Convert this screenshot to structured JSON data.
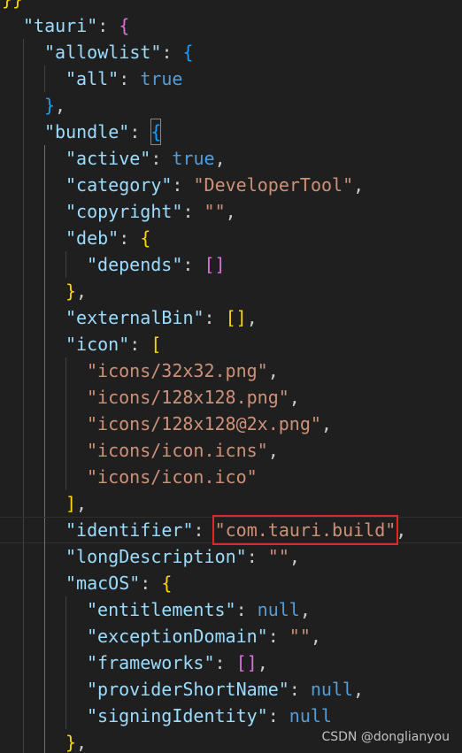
{
  "editor": {
    "language": "json",
    "lines": [
      {
        "indent": 0,
        "tokens": [
          {
            "t": "}}",
            "c": "brace-gold"
          }
        ]
      },
      {
        "indent": 1,
        "tokens": [
          {
            "t": "\"tauri\"",
            "c": "key"
          },
          {
            "t": ": ",
            "c": "punct"
          },
          {
            "t": "{",
            "c": "brace-purple"
          }
        ]
      },
      {
        "indent": 2,
        "tokens": [
          {
            "t": "\"allowlist\"",
            "c": "key"
          },
          {
            "t": ": ",
            "c": "punct"
          },
          {
            "t": "{",
            "c": "brace-blue"
          }
        ]
      },
      {
        "indent": 3,
        "tokens": [
          {
            "t": "\"all\"",
            "c": "key"
          },
          {
            "t": ": ",
            "c": "punct"
          },
          {
            "t": "true",
            "c": "kw"
          }
        ]
      },
      {
        "indent": 2,
        "tokens": [
          {
            "t": "}",
            "c": "brace-blue"
          },
          {
            "t": ",",
            "c": "punct"
          }
        ]
      },
      {
        "indent": 2,
        "tokens": [
          {
            "t": "\"bundle\"",
            "c": "key"
          },
          {
            "t": ": ",
            "c": "punct"
          },
          {
            "t": "{",
            "c": "brace-blue",
            "match": true
          }
        ]
      },
      {
        "indent": 3,
        "tokens": [
          {
            "t": "\"active\"",
            "c": "key"
          },
          {
            "t": ": ",
            "c": "punct"
          },
          {
            "t": "true",
            "c": "kw"
          },
          {
            "t": ",",
            "c": "punct"
          }
        ]
      },
      {
        "indent": 3,
        "tokens": [
          {
            "t": "\"category\"",
            "c": "key"
          },
          {
            "t": ": ",
            "c": "punct"
          },
          {
            "t": "\"DeveloperTool\"",
            "c": "str"
          },
          {
            "t": ",",
            "c": "punct"
          }
        ]
      },
      {
        "indent": 3,
        "tokens": [
          {
            "t": "\"copyright\"",
            "c": "key"
          },
          {
            "t": ": ",
            "c": "punct"
          },
          {
            "t": "\"\"",
            "c": "str"
          },
          {
            "t": ",",
            "c": "punct"
          }
        ]
      },
      {
        "indent": 3,
        "tokens": [
          {
            "t": "\"deb\"",
            "c": "key"
          },
          {
            "t": ": ",
            "c": "punct"
          },
          {
            "t": "{",
            "c": "brace-gold"
          }
        ]
      },
      {
        "indent": 4,
        "tokens": [
          {
            "t": "\"depends\"",
            "c": "key"
          },
          {
            "t": ": ",
            "c": "punct"
          },
          {
            "t": "[]",
            "c": "brace-purple"
          }
        ]
      },
      {
        "indent": 3,
        "tokens": [
          {
            "t": "}",
            "c": "brace-gold"
          },
          {
            "t": ",",
            "c": "punct"
          }
        ]
      },
      {
        "indent": 3,
        "tokens": [
          {
            "t": "\"externalBin\"",
            "c": "key"
          },
          {
            "t": ": ",
            "c": "punct"
          },
          {
            "t": "[]",
            "c": "brace-gold"
          },
          {
            "t": ",",
            "c": "punct"
          }
        ]
      },
      {
        "indent": 3,
        "tokens": [
          {
            "t": "\"icon\"",
            "c": "key"
          },
          {
            "t": ": ",
            "c": "punct"
          },
          {
            "t": "[",
            "c": "brace-gold"
          }
        ]
      },
      {
        "indent": 4,
        "tokens": [
          {
            "t": "\"icons/32x32.png\"",
            "c": "str"
          },
          {
            "t": ",",
            "c": "punct"
          }
        ]
      },
      {
        "indent": 4,
        "tokens": [
          {
            "t": "\"icons/128x128.png\"",
            "c": "str"
          },
          {
            "t": ",",
            "c": "punct"
          }
        ]
      },
      {
        "indent": 4,
        "tokens": [
          {
            "t": "\"icons/128x128@2x.png\"",
            "c": "str"
          },
          {
            "t": ",",
            "c": "punct"
          }
        ]
      },
      {
        "indent": 4,
        "tokens": [
          {
            "t": "\"icons/icon.icns\"",
            "c": "str"
          },
          {
            "t": ",",
            "c": "punct"
          }
        ]
      },
      {
        "indent": 4,
        "tokens": [
          {
            "t": "\"icons/icon.ico\"",
            "c": "str"
          }
        ]
      },
      {
        "indent": 3,
        "tokens": [
          {
            "t": "]",
            "c": "brace-gold"
          },
          {
            "t": ",",
            "c": "punct"
          }
        ]
      },
      {
        "indent": 3,
        "current": true,
        "tokens": [
          {
            "t": "\"identifier\"",
            "c": "key"
          },
          {
            "t": ": ",
            "c": "punct"
          },
          {
            "t": "\"com.tauri.build\"",
            "c": "str",
            "boxed": true
          },
          {
            "t": ",",
            "c": "punct"
          }
        ]
      },
      {
        "indent": 3,
        "tokens": [
          {
            "t": "\"longDescription\"",
            "c": "key"
          },
          {
            "t": ": ",
            "c": "punct"
          },
          {
            "t": "\"\"",
            "c": "str"
          },
          {
            "t": ",",
            "c": "punct"
          }
        ]
      },
      {
        "indent": 3,
        "tokens": [
          {
            "t": "\"macOS\"",
            "c": "key"
          },
          {
            "t": ": ",
            "c": "punct"
          },
          {
            "t": "{",
            "c": "brace-gold"
          }
        ]
      },
      {
        "indent": 4,
        "tokens": [
          {
            "t": "\"entitlements\"",
            "c": "key"
          },
          {
            "t": ": ",
            "c": "punct"
          },
          {
            "t": "null",
            "c": "kw"
          },
          {
            "t": ",",
            "c": "punct"
          }
        ]
      },
      {
        "indent": 4,
        "tokens": [
          {
            "t": "\"exceptionDomain\"",
            "c": "key"
          },
          {
            "t": ": ",
            "c": "punct"
          },
          {
            "t": "\"\"",
            "c": "str"
          },
          {
            "t": ",",
            "c": "punct"
          }
        ]
      },
      {
        "indent": 4,
        "tokens": [
          {
            "t": "\"frameworks\"",
            "c": "key"
          },
          {
            "t": ": ",
            "c": "punct"
          },
          {
            "t": "[]",
            "c": "brace-purple"
          },
          {
            "t": ",",
            "c": "punct"
          }
        ]
      },
      {
        "indent": 4,
        "tokens": [
          {
            "t": "\"providerShortName\"",
            "c": "key"
          },
          {
            "t": ": ",
            "c": "punct"
          },
          {
            "t": "null",
            "c": "kw"
          },
          {
            "t": ",",
            "c": "punct"
          }
        ]
      },
      {
        "indent": 4,
        "tokens": [
          {
            "t": "\"signingIdentity\"",
            "c": "key"
          },
          {
            "t": ": ",
            "c": "punct"
          },
          {
            "t": "null",
            "c": "kw"
          }
        ]
      },
      {
        "indent": 3,
        "tokens": [
          {
            "t": "}",
            "c": "brace-gold"
          },
          {
            "t": ",",
            "c": "punct"
          }
        ]
      }
    ]
  },
  "colors": {
    "background": "#1f1f1f",
    "key": "#9cdcfe",
    "string": "#ce9178",
    "keyword": "#569cd6",
    "brace_gold": "#ffd700",
    "brace_purple": "#da70d6",
    "brace_blue": "#179fff",
    "annotation_box": "#e0282a"
  },
  "watermark": {
    "text": "CSDN @donglianyou"
  }
}
